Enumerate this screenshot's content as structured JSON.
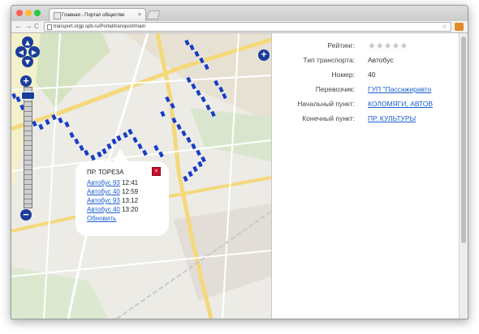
{
  "browser": {
    "tab_title": "Главная - Портал обществе",
    "tab_close": "×",
    "url": "transport.orgp.spb.ru/Portal/transport/main",
    "back_arrow": "←",
    "forward_arrow": "→",
    "reload_glyph": "C",
    "star_glyph": "☆",
    "traffic_colors": [
      "#fc5f57",
      "#fdbc2e",
      "#2ac940"
    ]
  },
  "map": {
    "zoom_in_label": "+",
    "zoom_out_label": "−",
    "layer_switcher_label": "+",
    "pan_arrows": [
      "▲",
      "◀",
      "▶",
      "▼"
    ],
    "zoom_level_fraction": 0.96,
    "stop_marker_color": "#1a3fc0",
    "popup": {
      "stop_name": "ПР. ТОРЕЗА",
      "close_glyph": "×",
      "arrivals": [
        {
          "route": "Автобус 93",
          "time": "12:41"
        },
        {
          "route": "Автобус 40",
          "time": "12:59"
        },
        {
          "route": "Автобус 93",
          "time": "13:12"
        },
        {
          "route": "Автобус 40",
          "time": "13:20"
        }
      ],
      "refresh_label": "Обновить"
    }
  },
  "info_panel": {
    "rating_label": "Рейтинг:",
    "rating_value": 0,
    "rating_max": 5,
    "rating_star_glyph": "★",
    "rows": [
      {
        "label": "Тип транспорта:",
        "value": "Автобус",
        "is_link": false
      },
      {
        "label": "Номер:",
        "value": "40",
        "is_link": false
      },
      {
        "label": "Перевозчик:",
        "value": "ГУП \"Пассажиравто",
        "is_link": true
      },
      {
        "label": "Начальный пункт:",
        "value": "КОЛОМЯГИ, АВТОВ",
        "is_link": true
      },
      {
        "label": "Конечный пункт:",
        "value": "ПР. КУЛЬТУРЫ",
        "is_link": true
      }
    ]
  }
}
